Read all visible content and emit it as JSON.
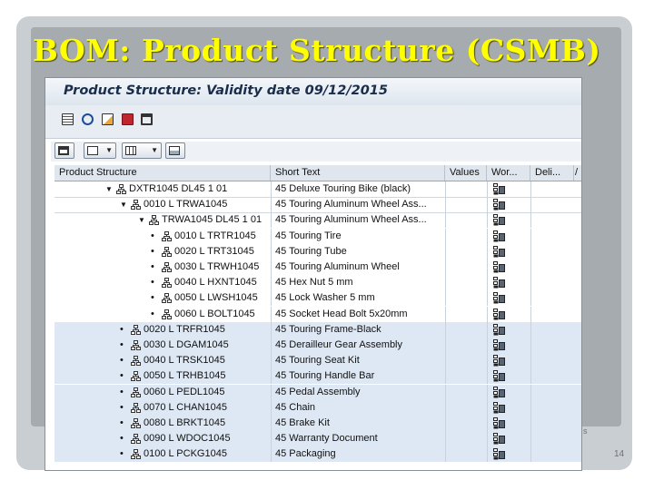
{
  "slide": {
    "title": "BOM: Product Structure (CSMB)",
    "number": "14",
    "footer_fragment": "s"
  },
  "screen": {
    "title": "Product Structure: Validity date 09/12/2015"
  },
  "grid": {
    "columns": [
      "Product Structure",
      "Short Text",
      "Values",
      "Wor...",
      "Deli...",
      "/"
    ],
    "rows": [
      {
        "level": 0,
        "expander": "collapse",
        "node": "DXTR1045 DL45 1 01",
        "text": "45 Deluxe Touring Bike (black)",
        "wor_icon": true,
        "hl": false
      },
      {
        "level": 1,
        "expander": "collapse",
        "node": "0010 L TRWA1045",
        "text": "45 Touring Aluminum Wheel Ass...",
        "wor_icon": true,
        "hl": false
      },
      {
        "level": 2,
        "expander": "collapse",
        "node": "TRWA1045 DL45 1 01",
        "text": "45 Touring Aluminum Wheel Ass...",
        "wor_icon": true,
        "hl": false
      },
      {
        "level": 3,
        "expander": "bullet",
        "node": "0010 L TRTR1045",
        "text": "45 Touring Tire",
        "wor_icon": true,
        "hl": false
      },
      {
        "level": 3,
        "expander": "bullet",
        "node": "0020 L TRT31045",
        "text": "45 Touring Tube",
        "wor_icon": true,
        "hl": false
      },
      {
        "level": 3,
        "expander": "bullet",
        "node": "0030 L TRWH1045",
        "text": "45 Touring Aluminum Wheel",
        "wor_icon": true,
        "hl": false
      },
      {
        "level": 3,
        "expander": "bullet",
        "node": "0040 L HXNT1045",
        "text": "45 Hex Nut 5 mm",
        "wor_icon": true,
        "hl": false
      },
      {
        "level": 3,
        "expander": "bullet",
        "node": "0050 L LWSH1045",
        "text": "45 Lock Washer 5 mm",
        "wor_icon": true,
        "hl": false
      },
      {
        "level": 3,
        "expander": "bullet",
        "node": "0060 L BOLT1045",
        "text": "45 Socket Head Bolt 5x20mm",
        "wor_icon": true,
        "hl": false
      },
      {
        "level": 1,
        "expander": "bullet",
        "node": "0020 L TRFR1045",
        "text": "45 Touring Frame-Black",
        "wor_icon": true,
        "hl": true
      },
      {
        "level": 1,
        "expander": "bullet",
        "node": "0030 L DGAM1045",
        "text": "45 Derailleur Gear Assembly",
        "wor_icon": true,
        "hl": true
      },
      {
        "level": 1,
        "expander": "bullet",
        "node": "0040 L TRSK1045",
        "text": "45 Touring Seat Kit",
        "wor_icon": true,
        "hl": true
      },
      {
        "level": 1,
        "expander": "bullet",
        "node": "0050 L TRHB1045",
        "text": "45 Touring Handle Bar",
        "wor_icon": true,
        "hl": true
      },
      {
        "level": 1,
        "expander": "bullet",
        "node": "0060 L PEDL1045",
        "text": "45 Pedal Assembly",
        "wor_icon": true,
        "hl": true
      },
      {
        "level": 1,
        "expander": "bullet",
        "node": "0070 L CHAN1045",
        "text": "45 Chain",
        "wor_icon": true,
        "hl": true
      },
      {
        "level": 1,
        "expander": "bullet",
        "node": "0080 L BRKT1045",
        "text": "45 Brake Kit",
        "wor_icon": true,
        "hl": true
      },
      {
        "level": 1,
        "expander": "bullet",
        "node": "0090 L WDOC1045",
        "text": "45 Warranty Document",
        "wor_icon": true,
        "hl": true
      },
      {
        "level": 1,
        "expander": "bullet",
        "node": "0100 L PCKG1045",
        "text": "45 Packaging",
        "wor_icon": true,
        "hl": true
      }
    ]
  },
  "colors": {
    "slide_title": "#ffff00",
    "row_highlight": "#dde8f4",
    "header_bg": "#dfe6ee"
  },
  "icons": {
    "toolbar": [
      "grid-view-icon",
      "refresh-icon",
      "copy-icon",
      "help-icon",
      "binoculars-icon"
    ],
    "alv": [
      "binoculars-icon",
      "layout-icon",
      "columns-icon",
      "export-icon"
    ],
    "node": "hierarchy-node-icon",
    "work_area": "workcenter-icon"
  }
}
